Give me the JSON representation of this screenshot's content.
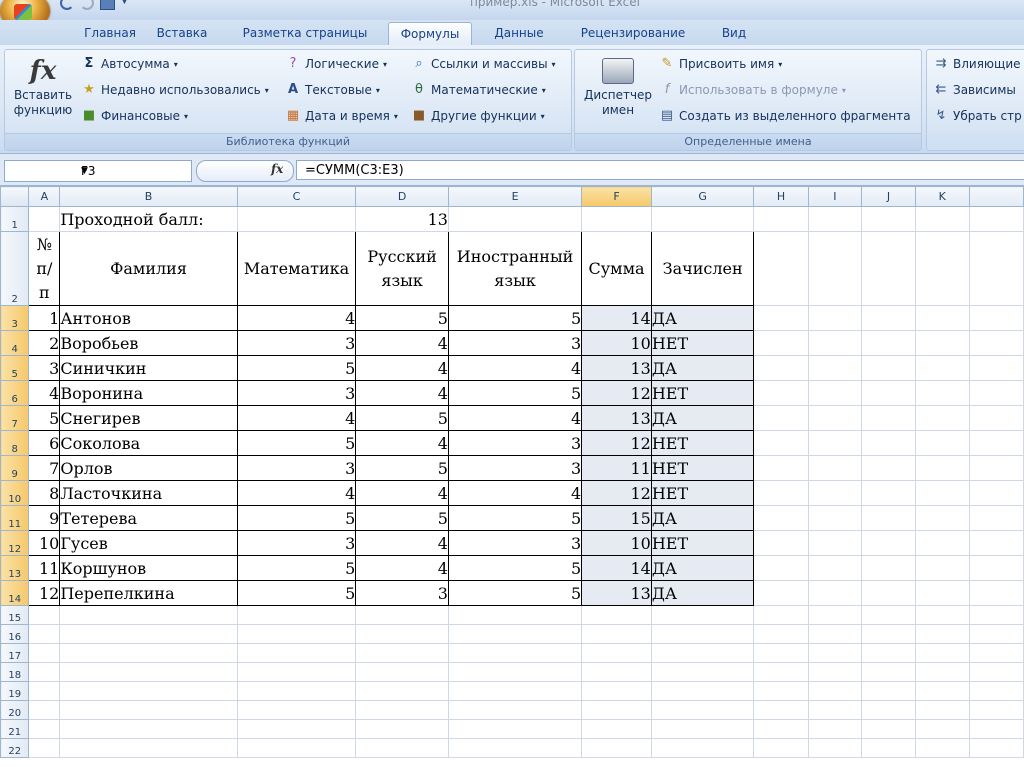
{
  "window": {
    "title": "пример.xls - Microsoft Excel"
  },
  "tabs": [
    "Главная",
    "Вставка",
    "Разметка страницы",
    "Формулы",
    "Данные",
    "Рецензирование",
    "Вид"
  ],
  "active_tab": "Формулы",
  "ribbon": {
    "insert_function": [
      "Вставить",
      "функцию"
    ],
    "library": {
      "autosum": "Автосумма",
      "recent": "Недавно использовались",
      "financial": "Финансовые",
      "logical": "Логические",
      "text": "Текстовые",
      "datetime": "Дата и время",
      "lookup": "Ссылки и массивы",
      "math": "Математические",
      "other": "Другие функции",
      "label": "Библиотека функций"
    },
    "names": {
      "manager": [
        "Диспетчер",
        "имен"
      ],
      "define": "Присвоить имя",
      "use_in_formula": "Использовать в формуле",
      "create_from_selection": "Создать из выделенного фрагмента",
      "label": "Определенные имена"
    },
    "audit": {
      "precedents": "Влияющие",
      "dependents": "Зависимы",
      "remove": "Убрать стр"
    }
  },
  "formula_bar": {
    "name_box": "F3",
    "fx": "fx",
    "formula": "=СУММ(C3:E3)"
  },
  "columns": [
    "A",
    "B",
    "C",
    "D",
    "E",
    "F",
    "G",
    "H",
    "I",
    "J",
    "K"
  ],
  "sheet": {
    "row1": {
      "label": "Проходной балл:",
      "value": "13"
    },
    "headers": {
      "num": [
        "№",
        "п/",
        "п"
      ],
      "surname": "Фамилия",
      "math": "Математика",
      "russian": [
        "Русский",
        "язык"
      ],
      "foreign": [
        "Иностранный",
        "язык"
      ],
      "sum": "Сумма",
      "enrolled": "Зачислен"
    },
    "rows": [
      {
        "n": "1",
        "name": "Антонов",
        "math": "4",
        "rus": "5",
        "for": "5",
        "sum": "14",
        "enr": "ДА"
      },
      {
        "n": "2",
        "name": "Воробьев",
        "math": "3",
        "rus": "4",
        "for": "3",
        "sum": "10",
        "enr": "НЕТ"
      },
      {
        "n": "3",
        "name": "Синичкин",
        "math": "5",
        "rus": "4",
        "for": "4",
        "sum": "13",
        "enr": "ДА"
      },
      {
        "n": "4",
        "name": "Воронина",
        "math": "3",
        "rus": "4",
        "for": "5",
        "sum": "12",
        "enr": "НЕТ"
      },
      {
        "n": "5",
        "name": "Снегирев",
        "math": "4",
        "rus": "5",
        "for": "4",
        "sum": "13",
        "enr": "ДА"
      },
      {
        "n": "6",
        "name": "Соколова",
        "math": "5",
        "rus": "4",
        "for": "3",
        "sum": "12",
        "enr": "НЕТ"
      },
      {
        "n": "7",
        "name": "Орлов",
        "math": "3",
        "rus": "5",
        "for": "3",
        "sum": "11",
        "enr": "НЕТ"
      },
      {
        "n": "8",
        "name": "Ласточкина",
        "math": "4",
        "rus": "4",
        "for": "4",
        "sum": "12",
        "enr": "НЕТ"
      },
      {
        "n": "9",
        "name": "Тетерева",
        "math": "5",
        "rus": "5",
        "for": "5",
        "sum": "15",
        "enr": "ДА"
      },
      {
        "n": "10",
        "name": "Гусев",
        "math": "3",
        "rus": "4",
        "for": "3",
        "sum": "10",
        "enr": "НЕТ"
      },
      {
        "n": "11",
        "name": "Коршунов",
        "math": "5",
        "rus": "4",
        "for": "5",
        "sum": "14",
        "enr": "ДА"
      },
      {
        "n": "12",
        "name": "Перепелкина",
        "math": "5",
        "rus": "3",
        "for": "5",
        "sum": "13",
        "enr": "ДА"
      }
    ],
    "row_numbers": [
      "1",
      "2",
      "3",
      "4",
      "5",
      "6",
      "7",
      "8",
      "9",
      "10",
      "11",
      "12",
      "13",
      "14",
      "15",
      "16",
      "17",
      "18",
      "19",
      "20",
      "21",
      "22"
    ]
  },
  "colors": {
    "ribbon": "#dbe7f5",
    "selection": "#e6eaf3",
    "header_selected": "#f5c86a",
    "tab_text": "#15428b"
  }
}
